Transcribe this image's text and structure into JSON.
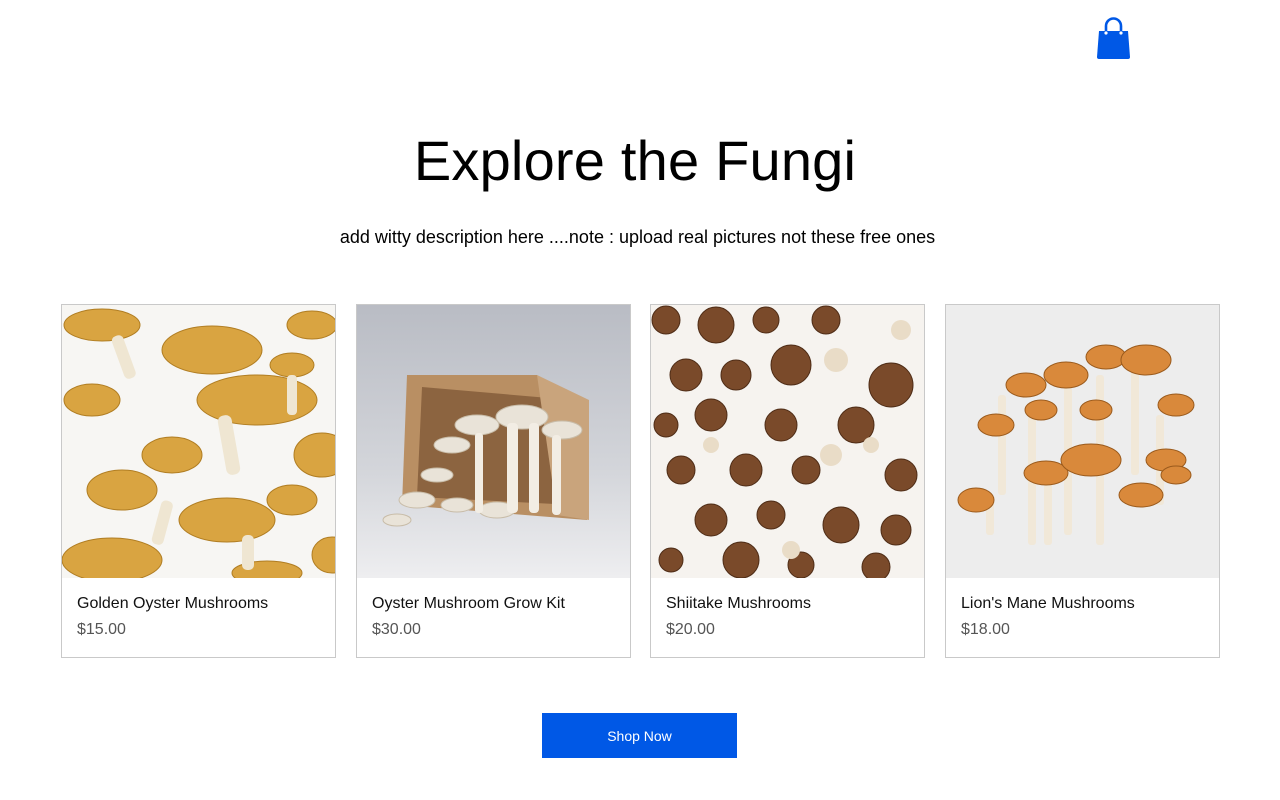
{
  "header": {
    "cart_icon": "shopping-bag-icon",
    "accent_color": "#0058e6"
  },
  "hero": {
    "title": "Explore the Fungi",
    "description": "add witty description here ....note : upload real pictures not these free ones"
  },
  "products": [
    {
      "name": "Golden Oyster Mushrooms",
      "price": "$15.00"
    },
    {
      "name": "Oyster Mushroom Grow Kit",
      "price": "$30.00"
    },
    {
      "name": "Shiitake Mushrooms",
      "price": "$20.00"
    },
    {
      "name": "Lion's Mane Mushrooms",
      "price": "$18.00"
    }
  ],
  "cta": {
    "label": "Shop Now"
  }
}
